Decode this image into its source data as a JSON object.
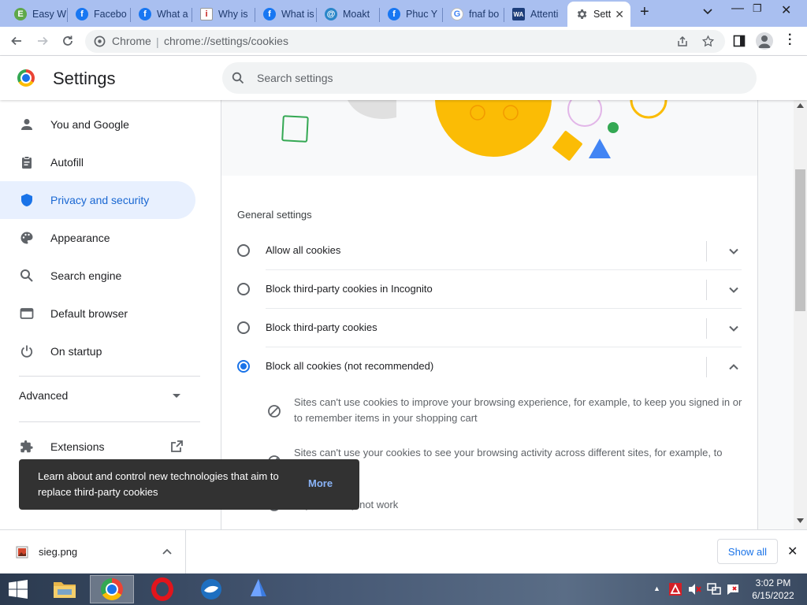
{
  "tabs": [
    {
      "title": "Easy W",
      "icon": "easyworship-icon"
    },
    {
      "title": "Facebo",
      "icon": "facebook-icon"
    },
    {
      "title": "What a",
      "icon": "facebook-icon"
    },
    {
      "title": "Why is",
      "icon": "info-icon"
    },
    {
      "title": "What is",
      "icon": "facebook-icon"
    },
    {
      "title": "Moakt",
      "icon": "moakt-icon"
    },
    {
      "title": "Phuc Y",
      "icon": "facebook-icon"
    },
    {
      "title": "fnaf bo",
      "icon": "google-icon"
    },
    {
      "title": "Attenti",
      "icon": "wa-icon"
    },
    {
      "title": "Sett",
      "icon": "gear-icon",
      "active": true
    }
  ],
  "toolbar": {
    "origin": "Chrome",
    "separator": "|",
    "url": "chrome://settings/cookies"
  },
  "header": {
    "title": "Settings",
    "search_placeholder": "Search settings"
  },
  "sidebar": {
    "items": [
      {
        "label": "You and Google",
        "icon": "person-icon"
      },
      {
        "label": "Autofill",
        "icon": "clipboard-icon"
      },
      {
        "label": "Privacy and security",
        "icon": "shield-icon",
        "active": true
      },
      {
        "label": "Appearance",
        "icon": "palette-icon"
      },
      {
        "label": "Search engine",
        "icon": "search-icon"
      },
      {
        "label": "Default browser",
        "icon": "browser-icon"
      },
      {
        "label": "On startup",
        "icon": "power-icon"
      }
    ],
    "advanced_label": "Advanced",
    "extensions_label": "Extensions"
  },
  "main": {
    "general_heading": "General settings",
    "options": [
      {
        "label": "Allow all cookies",
        "selected": false,
        "expanded": false
      },
      {
        "label": "Block third-party cookies in Incognito",
        "selected": false,
        "expanded": false
      },
      {
        "label": "Block third-party cookies",
        "selected": false,
        "expanded": false
      },
      {
        "label": "Block all cookies (not recommended)",
        "selected": true,
        "expanded": true
      }
    ],
    "details": [
      "Sites can't use cookies to improve your browsing experience, for example, to keep you signed in or to remember items in your shopping cart",
      "Sites can't use your cookies to see your browsing activity across different sites, for example, to",
      "s",
      "any sites may not work"
    ]
  },
  "toast": {
    "text": "Learn about and control new technologies that aim to replace third-party cookies",
    "action": "More"
  },
  "download": {
    "filename": "sieg.png",
    "show_all": "Show all"
  },
  "clock": {
    "time": "3:02 PM",
    "date": "6/15/2022"
  },
  "colors": {
    "accent": "#1a73e8",
    "tabstrip": "#a9bff0",
    "active_nav_bg": "#e8f0fe",
    "toast_bg": "#323232"
  }
}
